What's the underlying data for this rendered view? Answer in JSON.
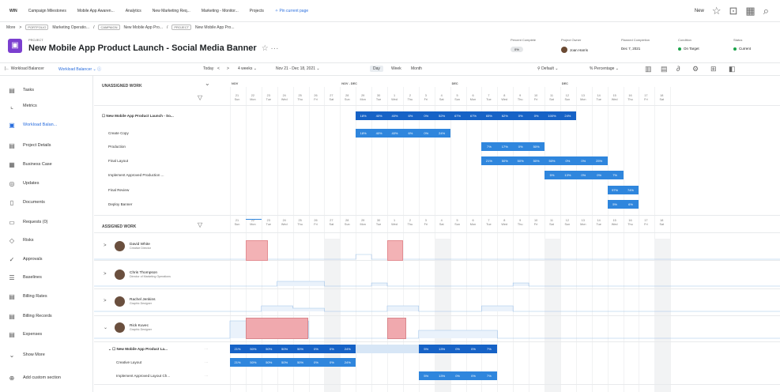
{
  "nav": {
    "tabs": [
      "WIN",
      "Campaign Milestones",
      "Mobile App Awaren...",
      "Analytics",
      "New Marketing Req...",
      "Marketing - Monitor...",
      "Projects"
    ],
    "pinned": "Pin current page",
    "new_label": "New",
    "icons": [
      "star-icon",
      "box-icon",
      "grid-icon",
      "search-icon"
    ]
  },
  "breadcrumb": {
    "more": "More",
    "portfolio_tag": "PORTFOLIO",
    "portfolio": "Marketing Operatio...",
    "campaign_tag": "CAMPAIGN",
    "campaign": "New Mobile App Pro...",
    "project_tag": "PROJECT",
    "project": "New Mobile App Pro..."
  },
  "project": {
    "label": "PROJECT",
    "title": "New Mobile App Product Launch - Social Media Banner",
    "star": "☆ ···",
    "percent_label": "Percent Complete",
    "percent": "0%",
    "owner_label": "Project Owner",
    "owner": "Joan Harris",
    "planned_label": "Planned Completion",
    "planned": "Dec 7, 2021",
    "condition_label": "Condition",
    "condition": "On Target",
    "status_label": "Status",
    "status": "Current",
    "accent": "#7b3fcf",
    "ok_color": "#1aa34a"
  },
  "toolbar": {
    "view_title": "Workload Balancer",
    "view_name": "Workload Balancer",
    "today": "Today",
    "range": "4 weeks",
    "dates": "Nov 21 - Dec 18, 2021",
    "day": "Day",
    "week": "Week",
    "month": "Month",
    "default": "Default",
    "percentage": "Percentage"
  },
  "sidebar": {
    "items": [
      {
        "label": "Tasks",
        "icon": "tasks-icon"
      },
      {
        "label": "Metrics",
        "icon": "metrics-icon"
      },
      {
        "label": "Workload Balan...",
        "icon": "workload-icon"
      },
      {
        "label": "Project Details",
        "icon": "details-icon"
      },
      {
        "label": "Business Case",
        "icon": "business-case-icon"
      },
      {
        "label": "Updates",
        "icon": "updates-icon"
      },
      {
        "label": "Documents",
        "icon": "documents-icon"
      },
      {
        "label": "Requests (0)",
        "icon": "requests-icon"
      },
      {
        "label": "Risks",
        "icon": "risks-icon"
      },
      {
        "label": "Approvals",
        "icon": "approvals-icon"
      },
      {
        "label": "Baselines",
        "icon": "baselines-icon"
      },
      {
        "label": "Billing Rates",
        "icon": "billing-rates-icon"
      },
      {
        "label": "Billing Records",
        "icon": "billing-records-icon"
      },
      {
        "label": "Expenses",
        "icon": "expenses-icon"
      },
      {
        "label": "Show More",
        "icon": "chevron-down-icon"
      },
      {
        "label": "Add custom section",
        "icon": "add-icon"
      }
    ]
  },
  "unassigned": {
    "header": "UNASSIGNED WORK",
    "weeks": [
      "NOV",
      "NOV - DEC",
      "DEC",
      "DEC"
    ],
    "days": [
      [
        "21",
        "Sun"
      ],
      [
        "22",
        "Mon"
      ],
      [
        "23",
        "Tue"
      ],
      [
        "24",
        "Wed"
      ],
      [
        "25",
        "Thu"
      ],
      [
        "26",
        "Fri"
      ],
      [
        "27",
        "Sat"
      ],
      [
        "28",
        "Sun"
      ],
      [
        "29",
        "Mon"
      ],
      [
        "30",
        "Tue"
      ],
      [
        "1",
        "Wed"
      ],
      [
        "2",
        "Thu"
      ],
      [
        "3",
        "Fri"
      ],
      [
        "4",
        "Sat"
      ],
      [
        "5",
        "Sun"
      ],
      [
        "6",
        "Mon"
      ],
      [
        "7",
        "Tue"
      ],
      [
        "8",
        "Wed"
      ],
      [
        "9",
        "Thu"
      ],
      [
        "10",
        "Fri"
      ],
      [
        "11",
        "Sat"
      ],
      [
        "12",
        "Sun"
      ],
      [
        "13",
        "Mon"
      ],
      [
        "14",
        "Tue"
      ],
      [
        "15",
        "Wed"
      ],
      [
        "16",
        "Thu"
      ],
      [
        "17",
        "Fri"
      ],
      [
        "18",
        "Sat"
      ]
    ],
    "rows": [
      {
        "label": "New Mobile App Product Launch - So...",
        "cells": [
          "18%",
          "40%",
          "40%",
          "6%",
          "0%",
          "52%",
          "67%",
          "67%",
          "65%",
          "62%",
          "0%",
          "0%",
          "100%",
          "24%"
        ]
      },
      {
        "label": "Create Copy",
        "cells": [
          "18%",
          "40%",
          "40%",
          "6%",
          "0%",
          "24%"
        ]
      },
      {
        "label": "Production",
        "cells": [
          "7%",
          "17%",
          "0%",
          "50%"
        ]
      },
      {
        "label": "Final Layout",
        "cells": [
          "21%",
          "50%",
          "50%",
          "50%",
          "50%",
          "0%",
          "0%",
          "25%"
        ]
      },
      {
        "label": "Implement Approved Production ...",
        "cells": [
          "5%",
          "13%",
          "0%",
          "0%",
          "7%"
        ]
      },
      {
        "label": "Final Review",
        "cells": [
          "97%",
          "74%"
        ]
      },
      {
        "label": "Deploy Banner",
        "cells": [
          "5%",
          "6%"
        ]
      }
    ]
  },
  "assigned": {
    "header": "ASSIGNED WORK",
    "people": [
      {
        "name": "David White",
        "role": "Creative Director"
      },
      {
        "name": "Chris Thompson",
        "role": "Director of Marketing Operations"
      },
      {
        "name": "Rachel Jenkins",
        "role": "Graphic Designer"
      },
      {
        "name": "Rick Kuvec",
        "role": "Graphic Designer"
      }
    ],
    "rows": [
      {
        "label": "New Mobile App Product La...",
        "cells": [
          "21%",
          "50%",
          "50%",
          "50%",
          "50%",
          "0%",
          "0%",
          "24%",
          "5%",
          "13%",
          "0%",
          "0%",
          "7%"
        ]
      },
      {
        "label": "Creative Layout",
        "cells": [
          "21%",
          "50%",
          "50%",
          "50%",
          "50%",
          "0%",
          "0%",
          "24%"
        ]
      },
      {
        "label": "Implement Approved Layout Ch...",
        "cells": [
          "5%",
          "13%",
          "0%",
          "0%",
          "7%"
        ]
      }
    ]
  },
  "colors": {
    "bar": "#2f86dd",
    "bar_dark": "#1662c6",
    "over": "#f3b2b5"
  }
}
